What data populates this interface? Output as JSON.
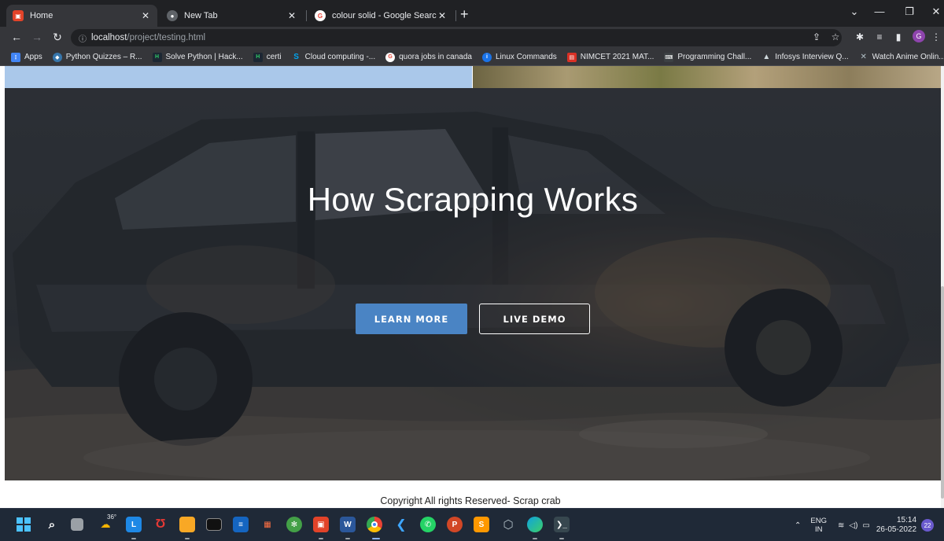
{
  "browser": {
    "tabs": [
      {
        "title": "Home",
        "favicon": "gitlab-icon",
        "color": "#e24329",
        "active": true
      },
      {
        "title": "New Tab",
        "favicon": "chrome-icon",
        "color": "#5f6368",
        "active": false
      },
      {
        "title": "colour solid - Google Search",
        "favicon": "google-icon",
        "color": "#ea4335",
        "active": false
      }
    ],
    "tab_close_glyph": "✕",
    "new_tab_glyph": "+",
    "url_host": "localhost",
    "url_path": "/project/testing.html",
    "bookmarks": [
      {
        "label": "Apps",
        "icon": "apps-grid-icon",
        "color": "#4285f4"
      },
      {
        "label": "Python Quizzes – R...",
        "icon": "python-icon",
        "color": "#3776ab"
      },
      {
        "label": "Solve Python | Hack...",
        "icon": "hackerrank-icon",
        "color": "#2ec866"
      },
      {
        "label": "certi",
        "icon": "hackerrank-icon",
        "color": "#2ec866"
      },
      {
        "label": "Cloud computing -...",
        "icon": "cloud-icon",
        "color": "#00a4ef"
      },
      {
        "label": "quora jobs in canada",
        "icon": "google-icon",
        "color": "#ea4335"
      },
      {
        "label": "Linux Commands",
        "icon": "linux-icon",
        "color": "#1a73e8"
      },
      {
        "label": "NIMCET 2021 MAT...",
        "icon": "document-icon",
        "color": "#d93025"
      },
      {
        "label": "Programming Chall...",
        "icon": "code-icon",
        "color": "#5f6368"
      },
      {
        "label": "Infosys Interview Q...",
        "icon": "triangle-icon",
        "color": "#34a853"
      },
      {
        "label": "Watch Anime Onlin...",
        "icon": "anime-icon",
        "color": "#8e24aa"
      }
    ]
  },
  "page": {
    "hero_title": "How Scrapping Works",
    "learn_more_label": "LEARN MORE",
    "live_demo_label": "LIVE DEMO",
    "footer_text": "Copyright All rights Reserved- Scrap crab"
  },
  "taskbar": {
    "weather_temp": "36°",
    "apps": [
      {
        "name": "windows-start-icon",
        "label": "",
        "color": "#0078d4"
      },
      {
        "name": "search-icon",
        "label": "",
        "color": "transparent"
      },
      {
        "name": "task-view-icon",
        "label": "",
        "color": "#9aa0a6"
      },
      {
        "name": "weather-icon",
        "label": "",
        "color": "#f5b301"
      },
      {
        "name": "lumion-icon",
        "label": "L",
        "color": "#1e88e5"
      },
      {
        "name": "mcafee-icon",
        "label": "",
        "color": "#c62828"
      },
      {
        "name": "file-explorer-icon",
        "label": "",
        "color": "#f9a825"
      },
      {
        "name": "terminal-icon",
        "label": "",
        "color": "#263238"
      },
      {
        "name": "notepad-icon",
        "label": "",
        "color": "#1565c0"
      },
      {
        "name": "office-icon",
        "label": "",
        "color": "#d84315"
      },
      {
        "name": "xbox-icon",
        "label": "",
        "color": "#43a047"
      },
      {
        "name": "gitlab-icon",
        "label": "",
        "color": "#e24329"
      },
      {
        "name": "word-icon",
        "label": "W",
        "color": "#2b579a"
      },
      {
        "name": "chrome-icon",
        "label": "",
        "color": "#fbbc05"
      },
      {
        "name": "vscode-icon",
        "label": "",
        "color": "#007acc"
      },
      {
        "name": "whatsapp-icon",
        "label": "",
        "color": "#25d366"
      },
      {
        "name": "powerpoint-icon",
        "label": "P",
        "color": "#d24726"
      },
      {
        "name": "sublime-icon",
        "label": "S",
        "color": "#ff9800"
      },
      {
        "name": "virtualbox-icon",
        "label": "",
        "color": "#90a4ae"
      },
      {
        "name": "edge-icon",
        "label": "",
        "color": "#0fa2e0"
      },
      {
        "name": "powershell-icon",
        "label": "",
        "color": "#37474f"
      }
    ],
    "tray": {
      "lang_top": "ENG",
      "lang_bottom": "IN",
      "time": "15:14",
      "date": "26-05-2022",
      "notification_count": "22"
    }
  }
}
